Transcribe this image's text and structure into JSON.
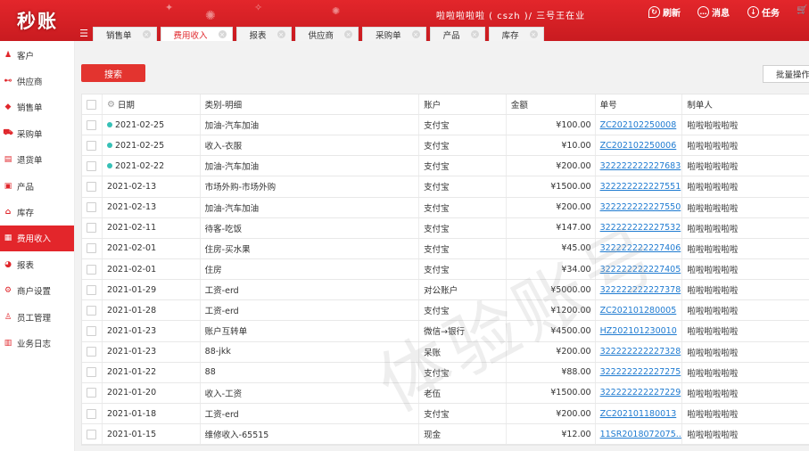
{
  "app": {
    "logo_text": "秒账"
  },
  "header": {
    "user_text": "啦啦啦啦啦 ( cszh )/ 三号王在业",
    "refresh_label": "刷新",
    "message_label": "消息",
    "task_label": "任务"
  },
  "tabs": [
    {
      "label": "销售单"
    },
    {
      "label": "费用收入"
    },
    {
      "label": "报表"
    },
    {
      "label": "供应商"
    },
    {
      "label": "采购单"
    },
    {
      "label": "产品"
    },
    {
      "label": "库存"
    }
  ],
  "sidebar": {
    "items": [
      {
        "label": "客户",
        "icon": "customer-icon"
      },
      {
        "label": "供应商",
        "icon": "supplier-icon"
      },
      {
        "label": "销售单",
        "icon": "sales-icon"
      },
      {
        "label": "采购单",
        "icon": "purchase-icon"
      },
      {
        "label": "退货单",
        "icon": "return-icon"
      },
      {
        "label": "产品",
        "icon": "product-icon"
      },
      {
        "label": "库存",
        "icon": "inventory-icon"
      },
      {
        "label": "费用收入",
        "icon": "expense-icon"
      },
      {
        "label": "报表",
        "icon": "report-icon"
      },
      {
        "label": "商户设置",
        "icon": "settings-icon"
      },
      {
        "label": "员工管理",
        "icon": "staff-icon"
      },
      {
        "label": "业务日志",
        "icon": "log-icon"
      }
    ]
  },
  "toolbar": {
    "search_label": "搜索",
    "batch_label": "批量操作"
  },
  "table": {
    "headers": {
      "date": "日期",
      "category": "类别-明细",
      "account": "账户",
      "amount": "金额",
      "number": "单号",
      "maker": "制单人"
    },
    "rows": [
      {
        "date": "2021-02-25",
        "category": "加油-汽车加油",
        "account": "支付宝",
        "amount": "¥100.00",
        "number": "ZC202102250008",
        "maker": "啦啦啦啦啦啦"
      },
      {
        "date": "2021-02-25",
        "category": "收入-衣服",
        "account": "支付宝",
        "amount": "¥10.00",
        "number": "ZC202102250006",
        "maker": "啦啦啦啦啦啦"
      },
      {
        "date": "2021-02-22",
        "category": "加油-汽车加油",
        "account": "支付宝",
        "amount": "¥200.00",
        "number": "322222222227683",
        "maker": "啦啦啦啦啦啦"
      },
      {
        "date": "2021-02-13",
        "category": "市场外购-市场外购",
        "account": "支付宝",
        "amount": "¥1500.00",
        "number": "322222222227551",
        "maker": "啦啦啦啦啦啦"
      },
      {
        "date": "2021-02-13",
        "category": "加油-汽车加油",
        "account": "支付宝",
        "amount": "¥200.00",
        "number": "322222222227550",
        "maker": "啦啦啦啦啦啦"
      },
      {
        "date": "2021-02-11",
        "category": "待客-吃饭",
        "account": "支付宝",
        "amount": "¥147.00",
        "number": "322222222227532",
        "maker": "啦啦啦啦啦啦"
      },
      {
        "date": "2021-02-01",
        "category": "住房-买水果",
        "account": "支付宝",
        "amount": "¥45.00",
        "number": "322222222227406",
        "maker": "啦啦啦啦啦啦"
      },
      {
        "date": "2021-02-01",
        "category": "住房",
        "account": "支付宝",
        "amount": "¥34.00",
        "number": "322222222227405",
        "maker": "啦啦啦啦啦啦"
      },
      {
        "date": "2021-01-29",
        "category": "工资-erd",
        "account": "对公账户",
        "amount": "¥5000.00",
        "number": "322222222227378",
        "maker": "啦啦啦啦啦啦"
      },
      {
        "date": "2021-01-28",
        "category": "工资-erd",
        "account": "支付宝",
        "amount": "¥1200.00",
        "number": "ZC202101280005",
        "maker": "啦啦啦啦啦啦"
      },
      {
        "date": "2021-01-23",
        "category": "账户互转单",
        "account": "微信→银行",
        "amount": "¥4500.00",
        "number": "HZ202101230010",
        "maker": "啦啦啦啦啦啦"
      },
      {
        "date": "2021-01-23",
        "category": "88-jkk",
        "account": "呆账",
        "amount": "¥200.00",
        "number": "322222222227328",
        "maker": "啦啦啦啦啦啦"
      },
      {
        "date": "2021-01-22",
        "category": "88",
        "account": "支付宝",
        "amount": "¥88.00",
        "number": "322222222227275",
        "maker": "啦啦啦啦啦啦"
      },
      {
        "date": "2021-01-20",
        "category": "收入-工资",
        "account": "老伍",
        "amount": "¥1500.00",
        "number": "322222222227229",
        "maker": "啦啦啦啦啦啦"
      },
      {
        "date": "2021-01-18",
        "category": "工资-erd",
        "account": "支付宝",
        "amount": "¥200.00",
        "number": "ZC202101180013",
        "maker": "啦啦啦啦啦啦"
      },
      {
        "date": "2021-01-15",
        "category": "维修收入-65515",
        "account": "现金",
        "amount": "¥12.00",
        "number": "11SR2018072075...",
        "maker": "啦啦啦啦啦啦"
      }
    ]
  },
  "watermark": "体验账号"
}
